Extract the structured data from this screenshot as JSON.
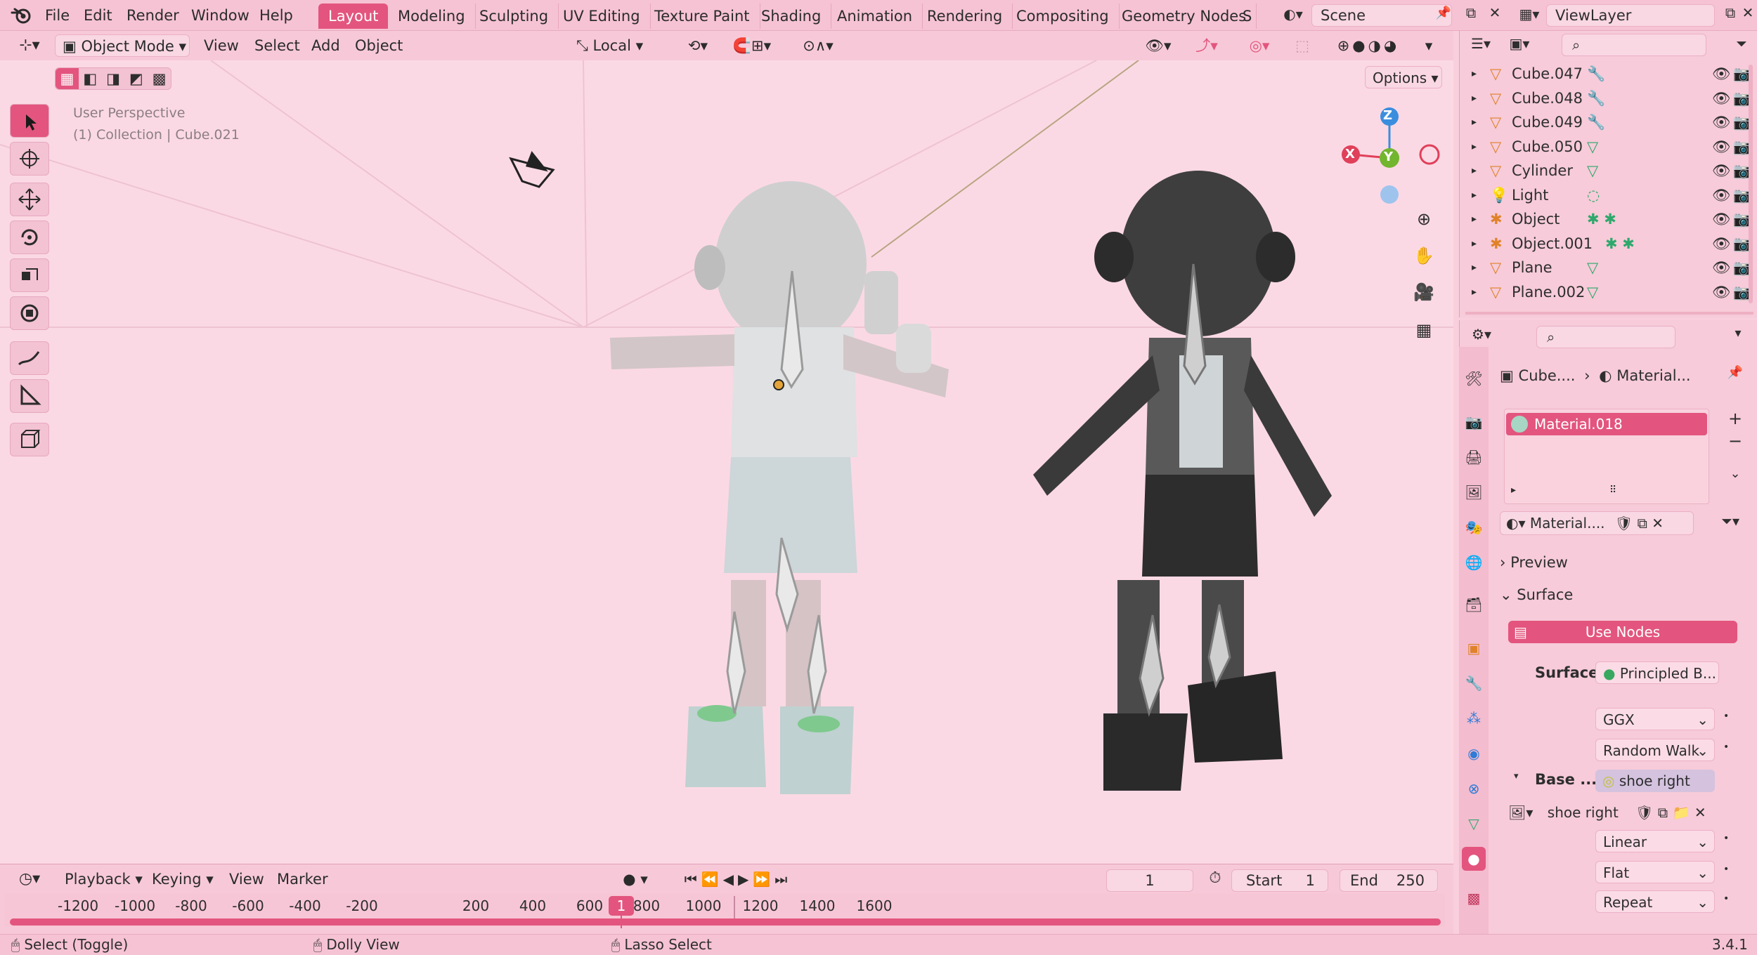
{
  "menu": {
    "file": "File",
    "edit": "Edit",
    "render": "Render",
    "window": "Window",
    "help": "Help"
  },
  "workspaces": [
    "Layout",
    "Modeling",
    "Sculpting",
    "UV Editing",
    "Texture Paint",
    "Shading",
    "Animation",
    "Rendering",
    "Compositing",
    "Geometry Nodes",
    "S"
  ],
  "scene": {
    "label": "Scene",
    "view_layer": "ViewLayer"
  },
  "viewport_header": {
    "mode": "Object Mode",
    "view": "View",
    "select": "Select",
    "add": "Add",
    "object": "Object",
    "transform_orientation": "Local",
    "options": "Options"
  },
  "viewport_overlay": {
    "line1": "User Perspective",
    "line2": "(1) Collection | Cube.021"
  },
  "gizmo": {
    "z": "Z",
    "y": "Y",
    "x": "X"
  },
  "outliner": {
    "items": [
      {
        "name": "Cube.047",
        "type": "mesh",
        "mod": "wrench"
      },
      {
        "name": "Cube.048",
        "type": "mesh",
        "mod": "wrench"
      },
      {
        "name": "Cube.049",
        "type": "mesh",
        "mod": "wrench"
      },
      {
        "name": "Cube.050",
        "type": "mesh",
        "mod": "mesh-data"
      },
      {
        "name": "Cylinder",
        "type": "mesh",
        "mod": "mesh-data"
      },
      {
        "name": "Light",
        "type": "light",
        "mod": "light-data"
      },
      {
        "name": "Object",
        "type": "armature",
        "mod": "armature-data"
      },
      {
        "name": "Object.001",
        "type": "armature",
        "mod": "armature-data"
      },
      {
        "name": "Plane",
        "type": "mesh",
        "mod": "mesh-data"
      },
      {
        "name": "Plane.002",
        "type": "mesh",
        "mod": "mesh-data"
      }
    ]
  },
  "properties": {
    "breadcrumb_object": "Cube....",
    "breadcrumb_material": "Material...",
    "material_slot": "Material.018",
    "material_name": "Material....",
    "preview": "Preview",
    "surface_panel": "Surface",
    "use_nodes": "Use Nodes",
    "surface_label": "Surface",
    "surface_value": "Principled B...",
    "distribution": "GGX",
    "subsurface": "Random Walk",
    "base_label": "Base ...",
    "base_value": "shoe right",
    "image_name": "shoe right",
    "interpolation": "Linear",
    "projection": "Flat",
    "extension": "Repeat"
  },
  "timeline": {
    "playback": "Playback",
    "keying": "Keying",
    "view": "View",
    "marker": "Marker",
    "current_frame": "1",
    "start_label": "Start",
    "start": "1",
    "end_label": "End",
    "end": "250",
    "ticks": [
      "-1200",
      "-1000",
      "-800",
      "-600",
      "-400",
      "-200",
      "1",
      "200",
      "400",
      "600",
      "800",
      "1000",
      "1200",
      "1400",
      "1600"
    ]
  },
  "statusbar": {
    "select": "Select (Toggle)",
    "dolly": "Dolly View",
    "lasso": "Lasso Select",
    "version": "3.4.1"
  },
  "colors": {
    "accent": "#e3557e",
    "bg": "#fbd9e4"
  }
}
